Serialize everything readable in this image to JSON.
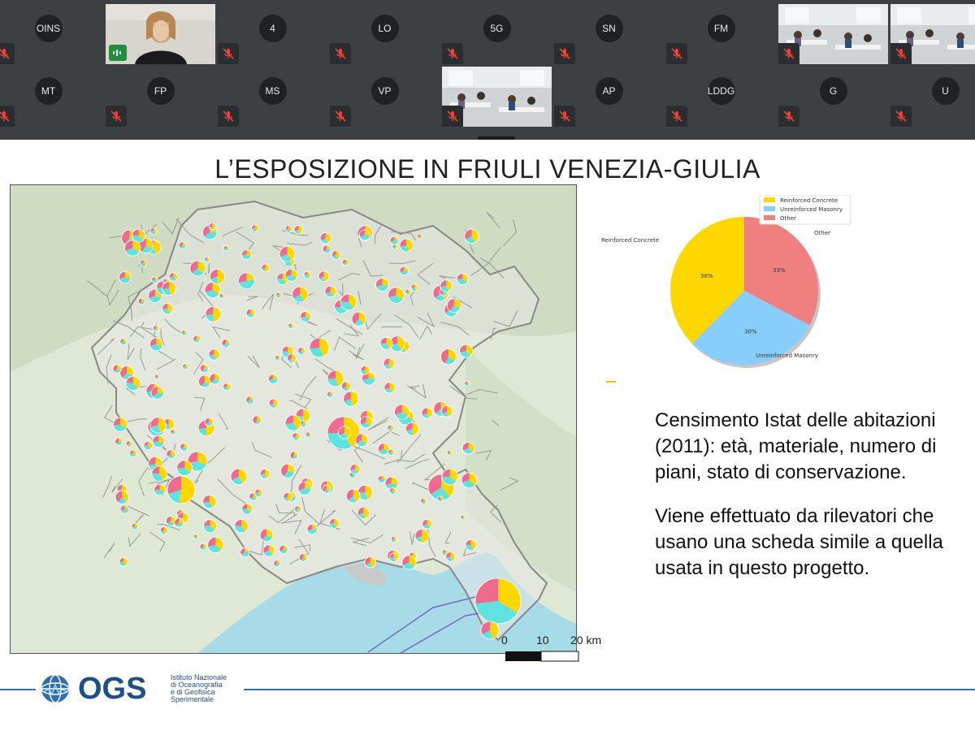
{
  "participants": [
    {
      "initials": "OINS",
      "state": "muted",
      "kind": "avatar"
    },
    {
      "initials": "",
      "state": "speaking",
      "kind": "video-person"
    },
    {
      "initials": "4",
      "state": "muted",
      "kind": "avatar"
    },
    {
      "initials": "LO",
      "state": "muted",
      "kind": "avatar"
    },
    {
      "initials": "5G",
      "state": "muted",
      "kind": "avatar"
    },
    {
      "initials": "SN",
      "state": "muted",
      "kind": "avatar"
    },
    {
      "initials": "FM",
      "state": "muted",
      "kind": "avatar"
    },
    {
      "initials": "",
      "state": "muted",
      "kind": "video-classroom"
    },
    {
      "initials": "",
      "state": "muted",
      "kind": "video-classroom"
    },
    {
      "initials": "MT",
      "state": "muted",
      "kind": "avatar"
    },
    {
      "initials": "FP",
      "state": "muted",
      "kind": "avatar"
    },
    {
      "initials": "MS",
      "state": "muted",
      "kind": "avatar"
    },
    {
      "initials": "VP",
      "state": "muted",
      "kind": "avatar"
    },
    {
      "initials": "",
      "state": "muted",
      "kind": "video-classroom"
    },
    {
      "initials": "AP",
      "state": "muted",
      "kind": "avatar"
    },
    {
      "initials": "LDDG",
      "state": "muted",
      "kind": "avatar"
    },
    {
      "initials": "G",
      "state": "muted",
      "kind": "avatar"
    },
    {
      "initials": "U",
      "state": "muted",
      "kind": "avatar"
    }
  ],
  "slide": {
    "title": "L’ESPOSIZIONE IN FRIULI VENEZIA-GIULIA",
    "paragraph1": "Censimento Istat delle abitazioni (2011): età, materiale, numero di piani, stato di conservazione.",
    "paragraph2": "Viene effettuato da rilevatori che usano una scheda simile a quella usata in questo progetto.",
    "scale": {
      "t0": "0",
      "t1": "10",
      "t2": "20 km"
    }
  },
  "chart_data": {
    "type": "pie",
    "title": "",
    "categories": [
      "Reinforced Concrete",
      "Unreinforced Masonry",
      "Other"
    ],
    "values": [
      38,
      30,
      33
    ],
    "value_labels": [
      "38%",
      "30%",
      "33%"
    ],
    "colors": [
      "#ffd700",
      "#87cefa",
      "#f08080"
    ],
    "legend": [
      "Reinforced Concrete",
      "Unreinforced Masonry",
      "Other"
    ],
    "legend_position": "top-right"
  },
  "logo": {
    "name": "OGS",
    "subtitle": "Istituto Nazionale\ndi Oceanografia\ne di Geofisica\nSperimentale"
  },
  "colors": {
    "concrete": "#ffd700",
    "masonry": "#5ee3e0",
    "other": "#f06a8e",
    "accent": "#1f4f86"
  }
}
